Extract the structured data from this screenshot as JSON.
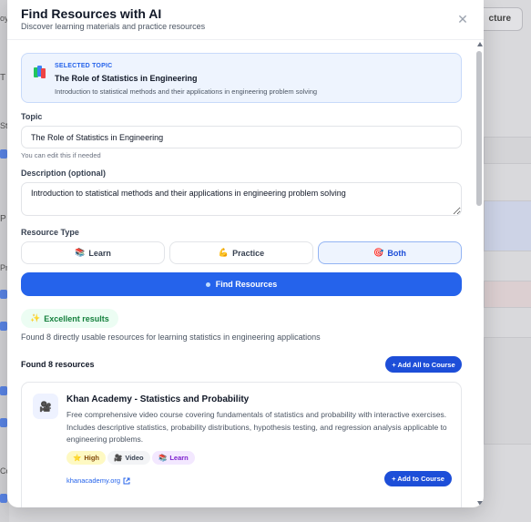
{
  "background": {
    "structure_button_label": "cture",
    "left_fragments": [
      "oy",
      "T",
      "St",
      "P",
      "Pr",
      "Co"
    ]
  },
  "modal": {
    "title": "Find Resources with AI",
    "subtitle": "Discover learning materials and practice resources",
    "close_icon": "close-icon"
  },
  "selected_topic": {
    "label": "SELECTED TOPIC",
    "title": "The Role of Statistics in Engineering",
    "description": "Introduction to statistical methods and their applications in engineering problem solving",
    "icon": "books-icon"
  },
  "form": {
    "topic_label": "Topic",
    "topic_value": "The Role of Statistics in Engineering",
    "topic_hint": "You can edit this if needed",
    "description_label": "Description (optional)",
    "description_value": "Introduction to statistical methods and their applications in engineering problem solving",
    "resource_type_label": "Resource Type",
    "resource_types": [
      {
        "emoji": "📚",
        "label": "Learn",
        "active": false
      },
      {
        "emoji": "💪",
        "label": "Practice",
        "active": false
      },
      {
        "emoji": "🎯",
        "label": "Both",
        "active": true
      }
    ],
    "submit_label": "Find Resources"
  },
  "results": {
    "quality_badge": "Excellent results",
    "quality_emoji": "✨",
    "summary": "Found 8 directly usable resources for learning statistics in engineering applications",
    "count_label": "Found 8 resources",
    "add_all_label": "+ Add All to Course",
    "items": [
      {
        "icon": "video-camera-icon",
        "title": "Khan Academy - Statistics and Probability",
        "description": "Free comprehensive video course covering fundamentals of statistics and probability with interactive exercises. Includes descriptive statistics, probability distributions, hypothesis testing, and regression analysis applicable to engineering problems.",
        "tags": [
          {
            "emoji": "⭐",
            "label": "High"
          },
          {
            "emoji": "🎥",
            "label": "Video"
          },
          {
            "emoji": "📚",
            "label": "Learn"
          }
        ],
        "link": "khanacademy.org",
        "add_label": "+ Add to Course"
      }
    ]
  },
  "colors": {
    "primary": "#2563eb",
    "primary_dark": "#1d4ed8",
    "topic_card_bg": "#eef4fe",
    "success_bg": "#ecfdf3",
    "success_text": "#15803d"
  }
}
